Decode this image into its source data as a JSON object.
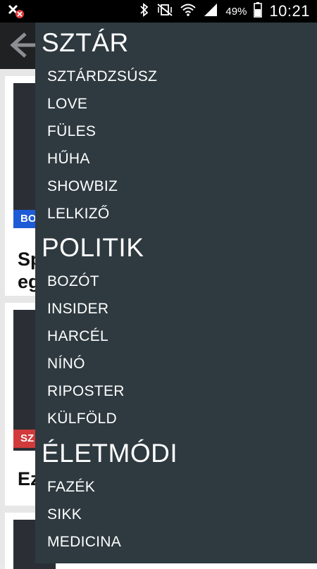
{
  "status_bar": {
    "battery_percent": "49%",
    "time": "10:21",
    "icons": [
      "notification-icon",
      "bluetooth-icon",
      "vibrate-mute-icon",
      "wifi-icon",
      "signal-icon",
      "battery-icon"
    ]
  },
  "background": {
    "cards": [
      {
        "badge": "BO",
        "badge_color": "#1e5bd6",
        "title_lines": [
          "Sp",
          "eg"
        ]
      },
      {
        "badge": "SZ",
        "badge_color": "#d13b3b",
        "title_lines": [
          "Ez"
        ]
      }
    ]
  },
  "drawer": {
    "sections": [
      {
        "title": "SZTÁR",
        "items": [
          "SZTÁRDZSÚSZ",
          "LOVE",
          "FÜLES",
          "HŰHA",
          "SHOWBIZ",
          "LELKIZŐ"
        ]
      },
      {
        "title": "POLITIK",
        "items": [
          "BOZÓT",
          "INSIDER",
          "HARCÉL",
          "NÍNÓ",
          "RIPOSTER",
          "KÜLFÖLD"
        ]
      },
      {
        "title": "ÉLETMÓDI",
        "items": [
          "FAZÉK",
          "SIKK",
          "MEDICINA"
        ]
      }
    ]
  }
}
